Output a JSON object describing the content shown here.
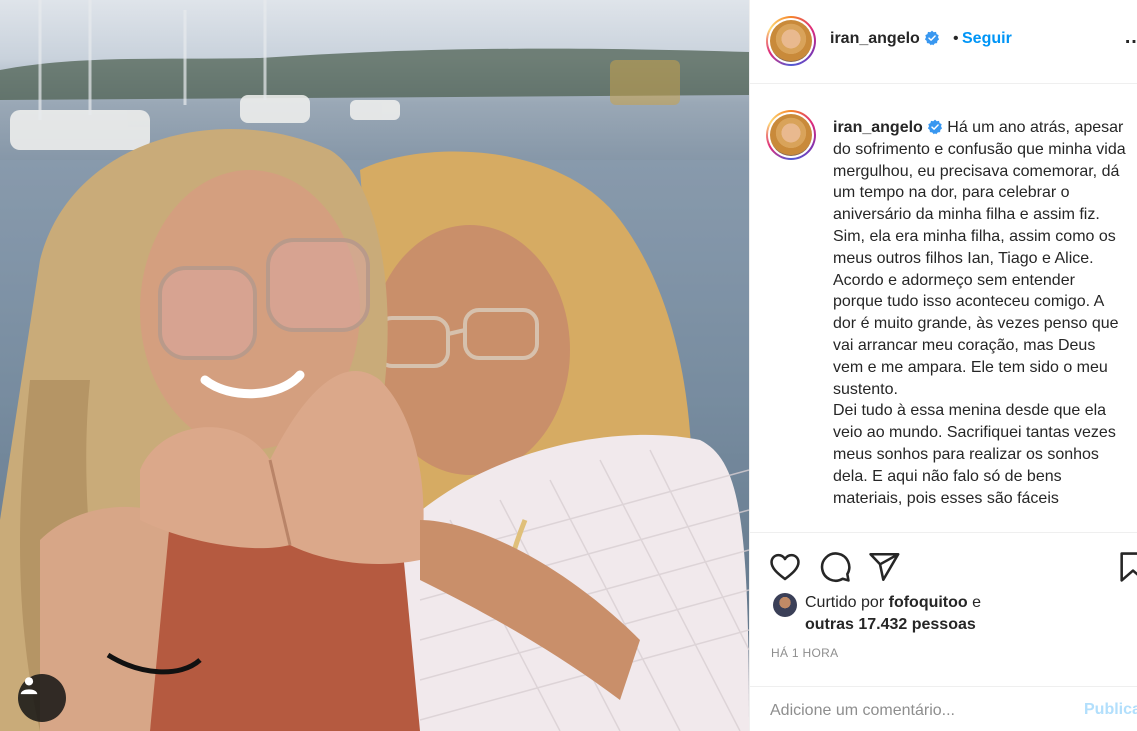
{
  "post": {
    "photo_alt": "",
    "user_tag_icon": "person-icon"
  },
  "header": {
    "username": "iran_angelo",
    "dot": "•",
    "follow_label": "Seguir",
    "more_label": "…"
  },
  "caption": {
    "username": "iran_angelo",
    "text": "Há um ano atrás, apesar do sofrimento e confusão que minha vida mergulhou, eu precisava comemorar, dá um tempo na dor, para celebrar o aniversário da minha filha e assim fiz. Sim, ela era minha filha, assim como os meus outros filhos Ian, Tiago e Alice.\nAcordo e adormeço sem entender porque tudo isso aconteceu comigo. A dor é muito grande, às vezes penso que vai arrancar meu coração, mas Deus vem e me ampara. Ele tem sido o meu sustento.\nDei tudo à essa menina desde que ela veio ao mundo. Sacrifiquei tantas vezes meus sonhos para realizar os sonhos dela. E aqui não falo só de bens materiais, pois esses são fáceis"
  },
  "actions": {
    "like_icon": "heart-icon",
    "comment_icon": "comment-icon",
    "share_icon": "share-icon",
    "save_icon": "bookmark-icon"
  },
  "likes": {
    "prefix": "Curtido por",
    "liker": "fofoquitoo",
    "conj": "e",
    "others": "outras 17.432 pessoas"
  },
  "timestamp": "HÁ 1 HORA",
  "comment": {
    "placeholder": "Adicione um comentário...",
    "publish_label": "Publicar"
  },
  "colors": {
    "link_blue": "#0095f6",
    "publish_disabled": "#b2dffc",
    "verified_blue": "#3897f0"
  }
}
